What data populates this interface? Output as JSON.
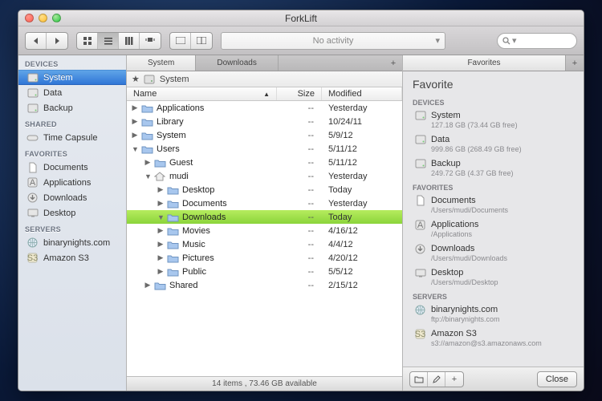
{
  "window": {
    "title": "ForkLift",
    "activity": "No activity",
    "search_placeholder": ""
  },
  "sidebar": {
    "sections": [
      {
        "title": "DEVICES",
        "items": [
          {
            "label": "System",
            "icon": "hdd",
            "selected": true
          },
          {
            "label": "Data",
            "icon": "hdd"
          },
          {
            "label": "Backup",
            "icon": "hdd"
          }
        ]
      },
      {
        "title": "SHARED",
        "items": [
          {
            "label": "Time Capsule",
            "icon": "capsule"
          }
        ]
      },
      {
        "title": "FAVORITES",
        "items": [
          {
            "label": "Documents",
            "icon": "doc"
          },
          {
            "label": "Applications",
            "icon": "app"
          },
          {
            "label": "Downloads",
            "icon": "down"
          },
          {
            "label": "Desktop",
            "icon": "desk"
          }
        ]
      },
      {
        "title": "SERVERS",
        "items": [
          {
            "label": "binarynights.com",
            "icon": "globe"
          },
          {
            "label": "Amazon S3",
            "icon": "s3"
          }
        ]
      }
    ]
  },
  "center": {
    "tabs": [
      {
        "label": "System",
        "active": true
      },
      {
        "label": "Downloads",
        "active": false
      }
    ],
    "path": {
      "label": "System",
      "icon": "hdd"
    },
    "columns": {
      "name": "Name",
      "size": "Size",
      "modified": "Modified"
    },
    "rows": [
      {
        "d": 0,
        "exp": "r",
        "icon": "folder",
        "name": "Applications",
        "size": "--",
        "mod": "Yesterday"
      },
      {
        "d": 0,
        "exp": "r",
        "icon": "folder",
        "name": "Library",
        "size": "--",
        "mod": "10/24/11"
      },
      {
        "d": 0,
        "exp": "r",
        "icon": "folder",
        "name": "System",
        "size": "--",
        "mod": "5/9/12"
      },
      {
        "d": 0,
        "exp": "d",
        "icon": "folder",
        "name": "Users",
        "size": "--",
        "mod": "5/11/12"
      },
      {
        "d": 1,
        "exp": "r",
        "icon": "folder",
        "name": "Guest",
        "size": "--",
        "mod": "5/11/12"
      },
      {
        "d": 1,
        "exp": "d",
        "icon": "home",
        "name": "mudi",
        "size": "--",
        "mod": "Yesterday"
      },
      {
        "d": 2,
        "exp": "r",
        "icon": "folder",
        "name": "Desktop",
        "size": "--",
        "mod": "Today"
      },
      {
        "d": 2,
        "exp": "r",
        "icon": "folder",
        "name": "Documents",
        "size": "--",
        "mod": "Yesterday"
      },
      {
        "d": 2,
        "exp": "d",
        "icon": "folder",
        "name": "Downloads",
        "size": "--",
        "mod": "Today",
        "selected": true
      },
      {
        "d": 2,
        "exp": "r",
        "icon": "folder",
        "name": "Movies",
        "size": "--",
        "mod": "4/16/12"
      },
      {
        "d": 2,
        "exp": "r",
        "icon": "folder",
        "name": "Music",
        "size": "--",
        "mod": "4/4/12"
      },
      {
        "d": 2,
        "exp": "r",
        "icon": "folder",
        "name": "Pictures",
        "size": "--",
        "mod": "4/20/12"
      },
      {
        "d": 2,
        "exp": "r",
        "icon": "folder",
        "name": "Public",
        "size": "--",
        "mod": "5/5/12"
      },
      {
        "d": 1,
        "exp": "r",
        "icon": "folder",
        "name": "Shared",
        "size": "--",
        "mod": "2/15/12"
      }
    ],
    "status": "14 items , 73.46 GB available"
  },
  "favorites": {
    "title": "Favorite",
    "tab": "Favorites",
    "sections": [
      {
        "title": "DEVICES",
        "items": [
          {
            "icon": "hdd",
            "label": "System",
            "sub": "127.18 GB (73.44 GB free)"
          },
          {
            "icon": "hdd",
            "label": "Data",
            "sub": "999.86 GB (268.49 GB free)"
          },
          {
            "icon": "hdd",
            "label": "Backup",
            "sub": "249.72 GB (4.37 GB free)"
          }
        ]
      },
      {
        "title": "FAVORITES",
        "items": [
          {
            "icon": "doc",
            "label": "Documents",
            "sub": "/Users/mudi/Documents"
          },
          {
            "icon": "app",
            "label": "Applications",
            "sub": "/Applications"
          },
          {
            "icon": "down",
            "label": "Downloads",
            "sub": "/Users/mudi/Downloads"
          },
          {
            "icon": "desk",
            "label": "Desktop",
            "sub": "/Users/mudi/Desktop"
          }
        ]
      },
      {
        "title": "SERVERS",
        "items": [
          {
            "icon": "globe",
            "label": "binarynights.com",
            "sub": "ftp://binarynights.com"
          },
          {
            "icon": "s3",
            "label": "Amazon S3",
            "sub": "s3://amazon@s3.amazonaws.com"
          }
        ]
      }
    ],
    "close": "Close"
  }
}
